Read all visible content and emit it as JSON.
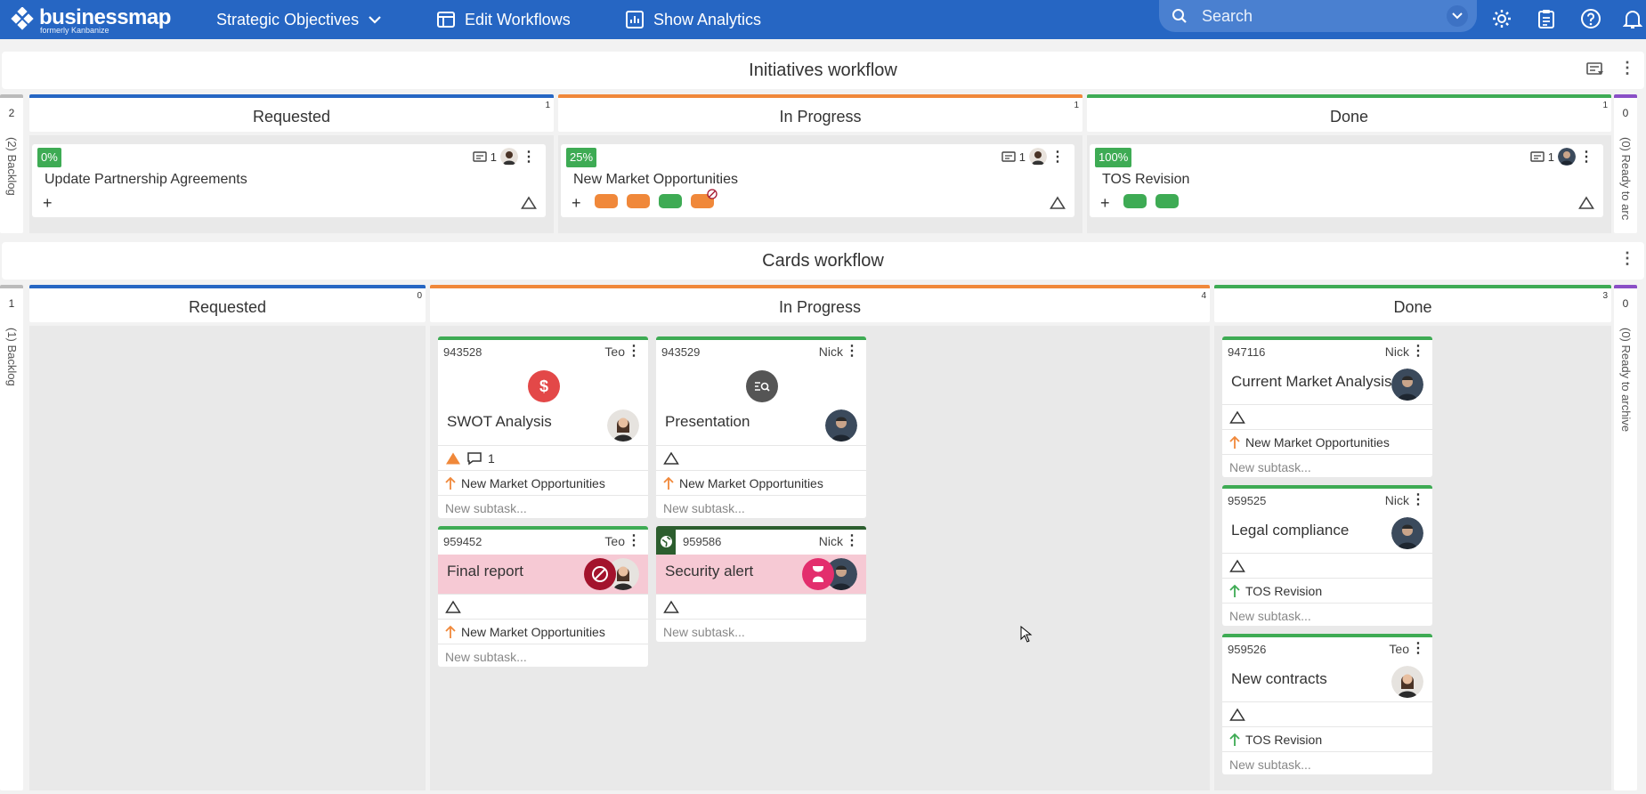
{
  "app": {
    "logo_name": "businessmap",
    "logo_sub": "formerly Kanbanize"
  },
  "nav": {
    "objectives": "Strategic Objectives",
    "edit": "Edit Workflows",
    "analytics": "Show Analytics"
  },
  "search": {
    "placeholder": "Search"
  },
  "initiatives": {
    "title": "Initiatives workflow",
    "side_left": {
      "count": "2",
      "label": "(2) Backlog"
    },
    "side_right": {
      "count": "0",
      "label": "(0) Ready to arc"
    },
    "columns": [
      {
        "title": "Requested",
        "count": "1"
      },
      {
        "title": "In Progress",
        "count": "1"
      },
      {
        "title": "Done",
        "count": "1"
      }
    ],
    "cards": [
      {
        "pct": "0%",
        "title": "Update Partnership Agreements",
        "cards_count": "1",
        "progress": 0
      },
      {
        "pct": "25%",
        "title": "New Market Opportunities",
        "cards_count": "1",
        "progress": 0.25
      },
      {
        "pct": "100%",
        "title": "TOS Revision",
        "cards_count": "1",
        "progress": 1
      }
    ]
  },
  "cards_wf": {
    "title": "Cards workflow",
    "side_left": {
      "count": "1",
      "label": "(1) Backlog"
    },
    "side_right": {
      "count": "0",
      "label": "(0) Ready to archive"
    },
    "columns": [
      {
        "title": "Requested",
        "count": "0"
      },
      {
        "title": "In Progress",
        "count": "4"
      },
      {
        "title": "Done",
        "count": "3"
      }
    ],
    "cards": [
      {
        "id": "943528",
        "owner": "Teo",
        "title": "SWOT Analysis",
        "comments": "1",
        "parent": "New Market Opportunities",
        "subtask": "New subtask..."
      },
      {
        "id": "943529",
        "owner": "Nick",
        "title": "Presentation",
        "parent": "New Market Opportunities",
        "subtask": "New subtask..."
      },
      {
        "id": "959452",
        "owner": "Teo",
        "title": "Final report",
        "parent": "New Market Opportunities",
        "subtask": "New subtask..."
      },
      {
        "id": "959586",
        "owner": "Nick",
        "title": "Security alert",
        "subtask": "New subtask..."
      },
      {
        "id": "947116",
        "owner": "Nick",
        "title": "Current Market Analysis",
        "parent": "New Market Opportunities",
        "subtask": "New subtask..."
      },
      {
        "id": "959525",
        "owner": "Nick",
        "title": "Legal compliance",
        "parent": "TOS Revision",
        "subtask": "New subtask..."
      },
      {
        "id": "959526",
        "owner": "Teo",
        "title": "New contracts",
        "parent": "TOS Revision",
        "subtask": "New subtask..."
      }
    ]
  },
  "colors": {
    "brand": "#2666c3",
    "requested": "#2666c3",
    "in_progress": "#f0883a",
    "done": "#3eab54",
    "archive": "#8a4fc6",
    "blocker": "#a3132c",
    "expedite": "#e32e6d"
  }
}
